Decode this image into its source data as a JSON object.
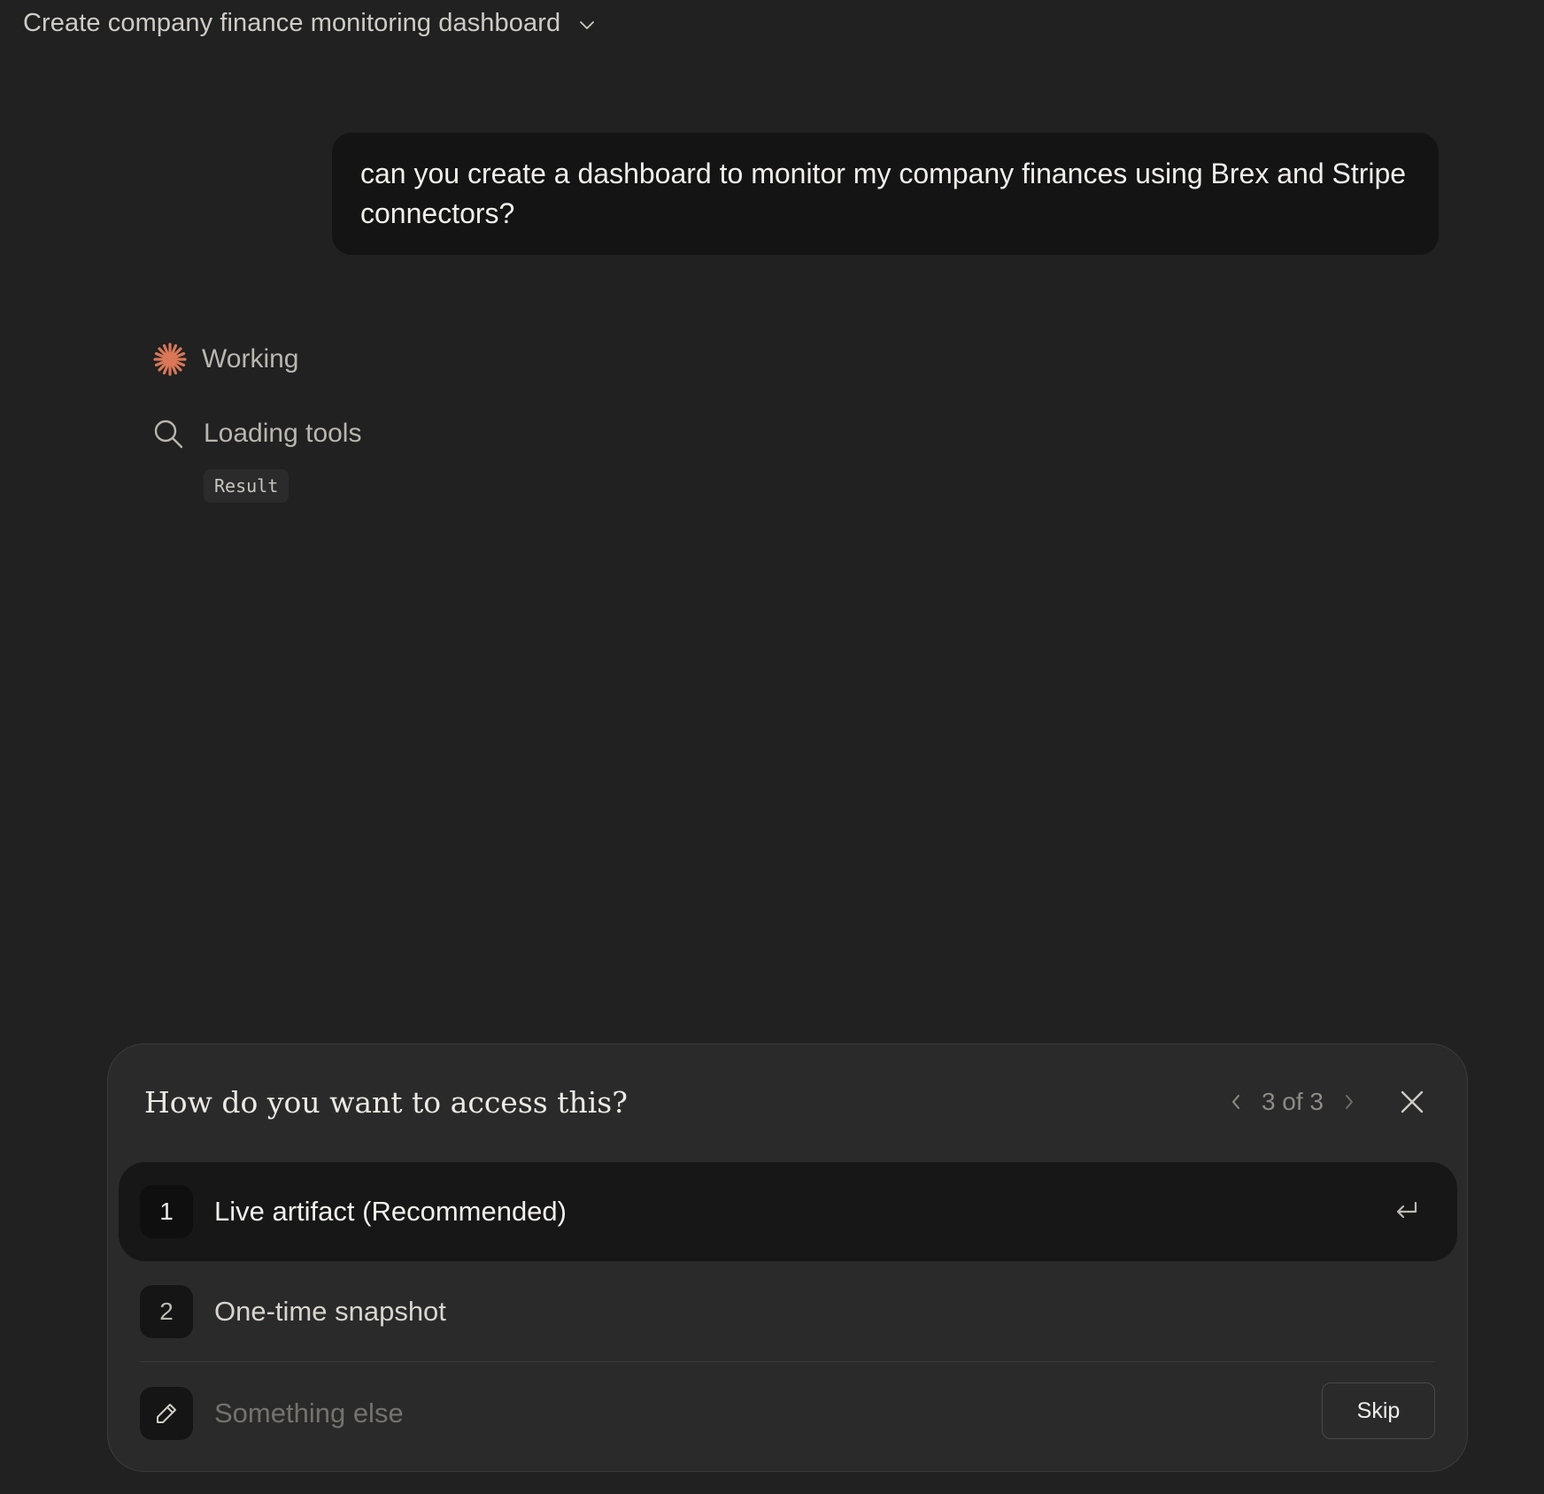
{
  "header": {
    "title": "Create company finance monitoring dashboard"
  },
  "conversation": {
    "user_message": "can you create a dashboard to monitor my company finances using Brex and Stripe connectors?",
    "status_label": "Working",
    "tool_step": {
      "label": "Loading tools",
      "result_label": "Result"
    }
  },
  "question_panel": {
    "title": "How do you want to access this?",
    "pager_text": "3 of 3",
    "options": [
      {
        "number": "1",
        "label": "Live artifact (Recommended)",
        "selected": true
      },
      {
        "number": "2",
        "label": "One-time snapshot",
        "selected": false
      }
    ],
    "other_placeholder": "Something else",
    "skip_label": "Skip"
  },
  "colors": {
    "background": "#212121",
    "accent": "#d97757",
    "panel": "#2a2a2a",
    "bubble": "#141414"
  },
  "icons": {
    "header": "chevron-down-icon",
    "status": "spark-icon",
    "tool": "search-icon",
    "pager_prev": "chevron-left-icon",
    "pager_next": "chevron-right-icon",
    "close": "close-icon",
    "enter": "enter-icon",
    "other": "pencil-icon"
  }
}
